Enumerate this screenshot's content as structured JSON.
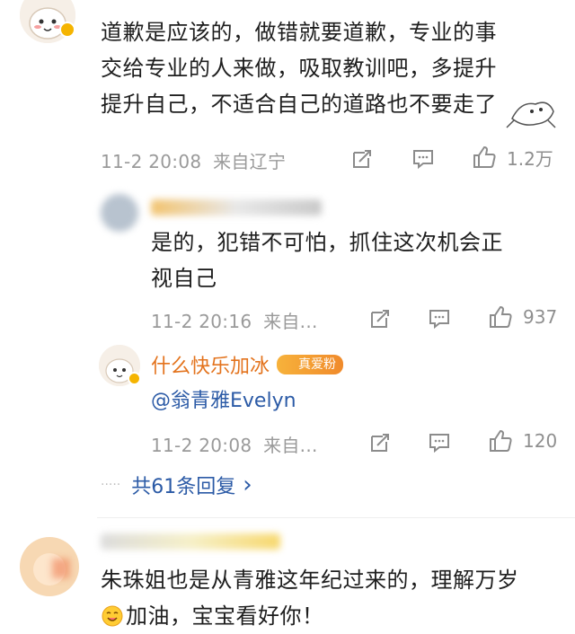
{
  "comment1": {
    "lines": [
      "道歉是应该的，做错就要道歉，专业的事",
      "交给专业的人来做，吸取教训吧，多提升",
      "提升自己，不适合自己的道路也不要走了"
    ],
    "time": "11-2 20:08",
    "source": "来自辽宁",
    "likes": "1.2万"
  },
  "reply1": {
    "lines": [
      "是的，犯错不可怕，抓住这次机会正",
      "视自己"
    ],
    "time": "11-2 20:16",
    "source": "来自...",
    "likes": "937"
  },
  "reply2": {
    "username": "什么快乐加冰",
    "badge": "真爱粉",
    "text": "@翁青雅Evelyn",
    "time": "11-2 20:08",
    "source": "来自...",
    "likes": "120"
  },
  "more_replies": {
    "dots": "·····",
    "label": "共61条回复",
    "chevron": "›"
  },
  "comment2": {
    "lines": [
      "朱珠姐也是从青雅这年纪过来的，理解万岁",
      "加油，宝宝看好你！"
    ]
  },
  "colors": {
    "username": "#e3731d",
    "link": "#2b5aa6",
    "meta": "#9a9a9a"
  },
  "icons": [
    "share-icon",
    "comment-icon",
    "like-icon",
    "verified-icon",
    "emoji-icon",
    "sticker-icon"
  ]
}
